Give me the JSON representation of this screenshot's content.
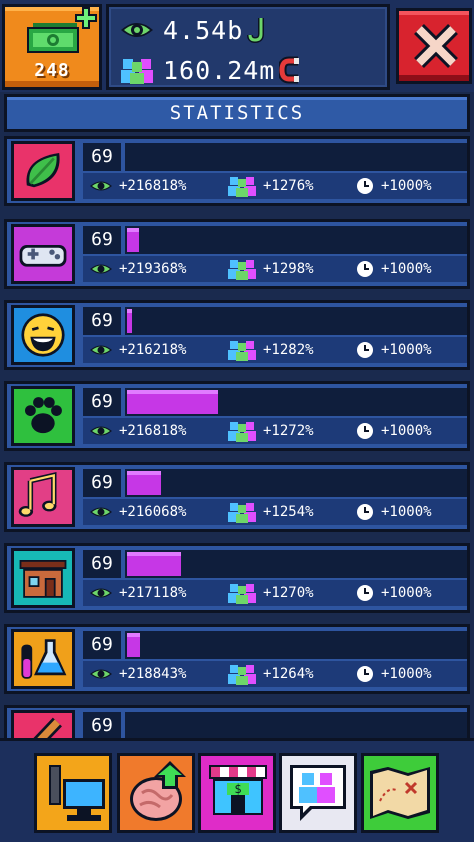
{
  "header": {
    "money_count": "248",
    "views": "4.54b",
    "followers": "160.24m"
  },
  "title": "STATISTICS",
  "items": [
    {
      "name": "leaf",
      "level": "69",
      "bar": 0.0,
      "views": "+216818%",
      "followers": "+1276%",
      "time": "+1000%",
      "bg": "#e9336a"
    },
    {
      "name": "gamepad",
      "level": "69",
      "bar": 0.036,
      "views": "+219368%",
      "followers": "+1298%",
      "time": "+1000%",
      "bg": "#c53ad9"
    },
    {
      "name": "laugh",
      "level": "69",
      "bar": 0.015,
      "views": "+216218%",
      "followers": "+1282%",
      "time": "+1000%",
      "bg": "#1f8ee0"
    },
    {
      "name": "paw",
      "level": "69",
      "bar": 0.27,
      "views": "+216818%",
      "followers": "+1272%",
      "time": "+1000%",
      "bg": "#2fc03e"
    },
    {
      "name": "music",
      "level": "69",
      "bar": 0.1,
      "views": "+216068%",
      "followers": "+1254%",
      "time": "+1000%",
      "bg": "#e23f86"
    },
    {
      "name": "house",
      "level": "69",
      "bar": 0.16,
      "views": "+217118%",
      "followers": "+1270%",
      "time": "+1000%",
      "bg": "#17b9b6"
    },
    {
      "name": "science",
      "level": "69",
      "bar": 0.037,
      "views": "+218843%",
      "followers": "+1264%",
      "time": "+1000%",
      "bg": "#f0a01a"
    },
    {
      "name": "bat",
      "level": "69",
      "bar": 0.0,
      "views": "",
      "followers": "",
      "time": "",
      "bg": "#e9336a"
    }
  ],
  "footer": {
    "buttons": [
      {
        "name": "computer",
        "bg": "#f3a51a"
      },
      {
        "name": "brain-upgrade",
        "bg": "#f07a2c"
      },
      {
        "name": "shop",
        "bg": "#df2cc8"
      },
      {
        "name": "social",
        "bg": "#e8e8f2"
      },
      {
        "name": "map",
        "bg": "#3ecc3a"
      }
    ]
  }
}
